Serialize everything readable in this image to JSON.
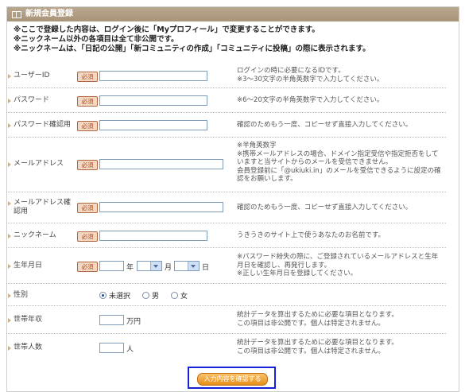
{
  "header": {
    "title": "新規会員登録"
  },
  "notices": [
    "※ここで登録した内容は、ログイン後に「Myプロフィール」で変更することができます。",
    "※ニックネーム以外の各項目は全て非公開です。",
    "※ニックネームは、「日記の公開」「新コミュニティの作成」「コミュニティに投稿」の際に表示されます。"
  ],
  "required_label": "必須",
  "fields": {
    "userid": {
      "label": "ユーザーID",
      "desc": [
        "ログインの時に必要になるIDです。",
        "※3〜30文字の半角英数字で入力してください。"
      ]
    },
    "password": {
      "label": "パスワード",
      "desc": [
        "※6〜20文字の半角英数字で入力してください。"
      ]
    },
    "password_confirm": {
      "label": "パスワード確認用",
      "desc": [
        "確認のためもう一度、コピーせず直接入力してください。"
      ]
    },
    "email": {
      "label": "メールアドレス",
      "desc": [
        "※半角英数字",
        "※携帯メールアドレスの場合、ドメイン指定受信や指定拒否をして",
        "いますと当サイトからのメールを受信できません。",
        "会員登録前に「@ukiuki.in」のメールを受信できるように設定の確",
        "認をお願いします。"
      ]
    },
    "email_confirm": {
      "label_line1": "メールアドレス確",
      "label_line2": "認用",
      "desc": [
        "確認のためもう一度、コピーせず直接入力してください。"
      ]
    },
    "nickname": {
      "label": "ニックネーム",
      "desc": [
        "うきうきのサイト上で使うあなたのお名前です。"
      ]
    },
    "birthday": {
      "label": "生年月日",
      "unit_year": "年",
      "unit_month": "月",
      "unit_day": "日",
      "desc": [
        "※パスワード紛失の際に、ご登録されているメールアドレスと生年",
        "月日を確認し、再発行します。",
        "※正しい生年月日を登録してください。"
      ]
    },
    "gender": {
      "label": "性別",
      "options": [
        "未選択",
        "男",
        "女"
      ],
      "selected": "未選択"
    },
    "income": {
      "label": "世帯年収",
      "unit": "万円",
      "desc": [
        "統計データを算出するために必要な項目となります。",
        "この項目は非公開です。個人は特定されません。"
      ]
    },
    "household": {
      "label": "世帯人数",
      "unit": "人",
      "desc": [
        "統計データを算出するために必要な項目となります。",
        "この項目は非公開です。個人は特定されません。"
      ]
    }
  },
  "submit_label": "入力内容を確認する"
}
